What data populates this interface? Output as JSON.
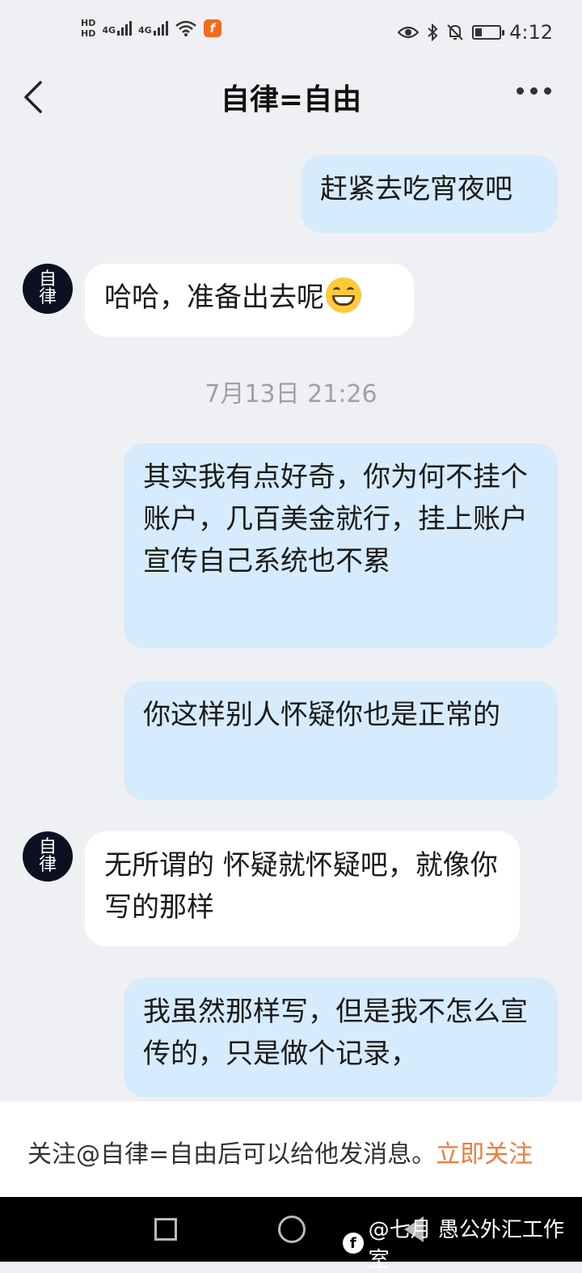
{
  "status_bar": {
    "hd1": "HD",
    "hd2": "HD",
    "sim1_network": "4G",
    "sim2_network": "4G",
    "time": "4:12",
    "battery_level": 0.3
  },
  "header": {
    "title": "自律=自由"
  },
  "messages": [
    {
      "side": "sent",
      "text": "赶紧去吃宵夜吧"
    },
    {
      "side": "received",
      "text": "哈哈，准备出去呢",
      "emoji": "grinning-squinting-face"
    },
    {
      "side": "sent",
      "text": "其实我有点好奇，你为何不挂个账户，几百美金就行，挂上账户宣传自己系统也不累"
    },
    {
      "side": "sent",
      "text": "你这样别人怀疑你也是正常的"
    },
    {
      "side": "received",
      "text": "无所谓的 怀疑就怀疑吧，就像你写的那样"
    },
    {
      "side": "sent",
      "text": "我虽然那样写，但是我不怎么宣传的，只是做个记录，"
    }
  ],
  "timestamp": "7月13日 21:26",
  "avatar": {
    "char1": "自",
    "char2": "律"
  },
  "footer": {
    "notice": "关注@自律=自由后可以给他发消息。",
    "follow_link": "立即关注"
  },
  "watermark": {
    "text": "@七月 愚公外汇工作室"
  }
}
